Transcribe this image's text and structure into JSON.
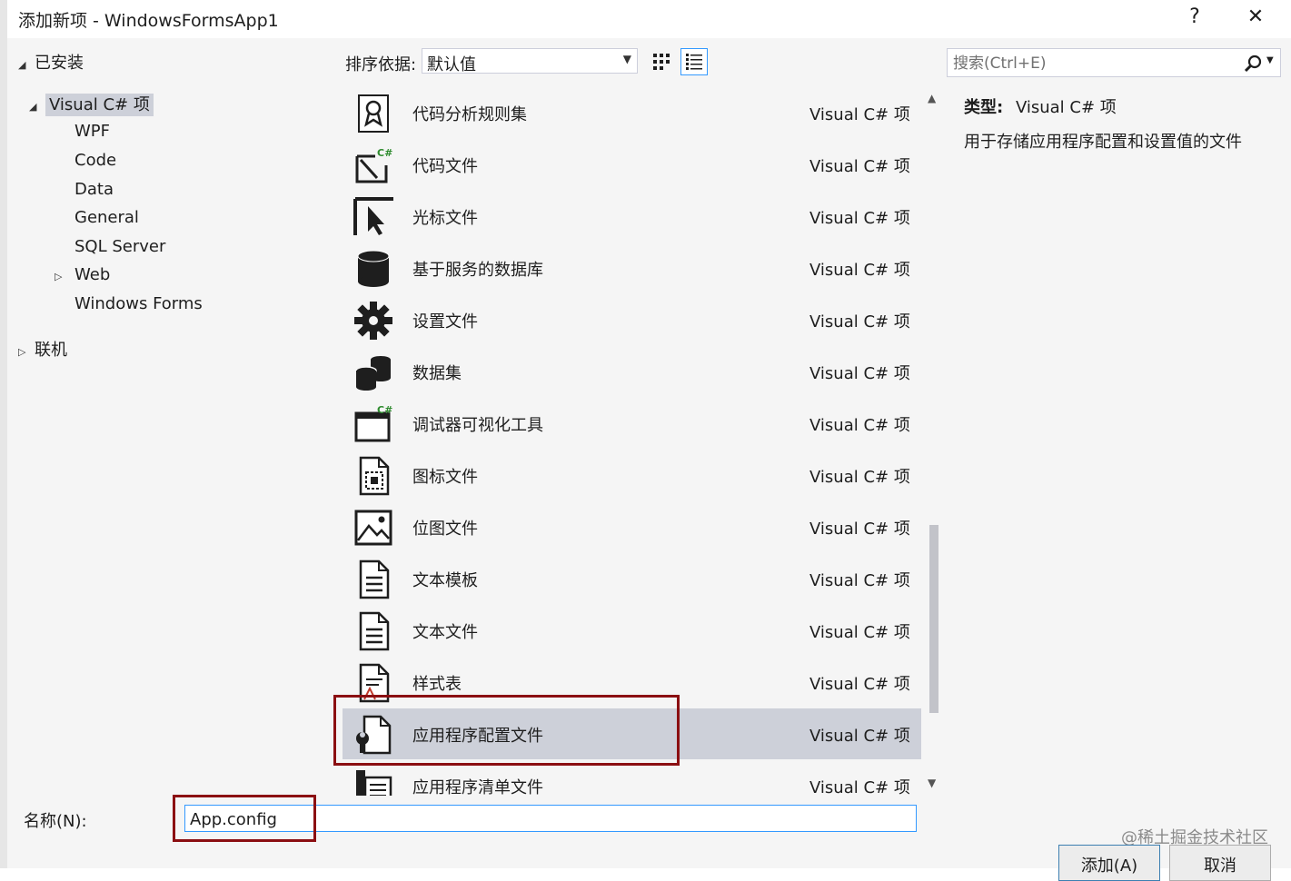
{
  "window": {
    "title": "添加新项 - WindowsFormsApp1",
    "help": "?",
    "close": "✕"
  },
  "tree": {
    "installed": "已安装",
    "visual_csharp": "Visual C# 项",
    "children": [
      "WPF",
      "Code",
      "Data",
      "General",
      "SQL Server",
      "Web",
      "Windows Forms"
    ],
    "online": "联机"
  },
  "toolbar": {
    "sort_label": "排序依据:",
    "sort_value": "默认值"
  },
  "search": {
    "placeholder": "搜索(Ctrl+E)"
  },
  "templates": [
    {
      "name": "代码分析规则集",
      "type": "Visual C# 项",
      "icon": "code-analysis-ruleset-icon"
    },
    {
      "name": "代码文件",
      "type": "Visual C# 项",
      "icon": "code-file-icon"
    },
    {
      "name": "光标文件",
      "type": "Visual C# 项",
      "icon": "cursor-file-icon"
    },
    {
      "name": "基于服务的数据库",
      "type": "Visual C# 项",
      "icon": "database-icon"
    },
    {
      "name": "设置文件",
      "type": "Visual C# 项",
      "icon": "gear-icon"
    },
    {
      "name": "数据集",
      "type": "Visual C# 项",
      "icon": "dataset-icon"
    },
    {
      "name": "调试器可视化工具",
      "type": "Visual C# 项",
      "icon": "debugger-visualizer-icon"
    },
    {
      "name": "图标文件",
      "type": "Visual C# 项",
      "icon": "icon-file-icon"
    },
    {
      "name": "位图文件",
      "type": "Visual C# 项",
      "icon": "bitmap-file-icon"
    },
    {
      "name": "文本模板",
      "type": "Visual C# 项",
      "icon": "text-template-icon"
    },
    {
      "name": "文本文件",
      "type": "Visual C# 项",
      "icon": "text-file-icon"
    },
    {
      "name": "样式表",
      "type": "Visual C# 项",
      "icon": "stylesheet-icon"
    },
    {
      "name": "应用程序配置文件",
      "type": "Visual C# 项",
      "icon": "app-config-icon"
    },
    {
      "name": "应用程序清单文件",
      "type": "Visual C# 项",
      "icon": "app-manifest-icon"
    }
  ],
  "selected_index": 12,
  "info": {
    "type_label": "类型:",
    "type_value": "Visual C# 项",
    "description": "用于存储应用程序配置和设置值的文件"
  },
  "name_field": {
    "label": "名称(N):",
    "value": "App.config"
  },
  "buttons": {
    "add": "添加(A)",
    "cancel": "取消"
  },
  "watermark": "@稀土掘金技术社区",
  "colors": {
    "selection": "#cdd0d9",
    "highlight_box": "#8b0f12",
    "focus_border": "#3399ff"
  }
}
